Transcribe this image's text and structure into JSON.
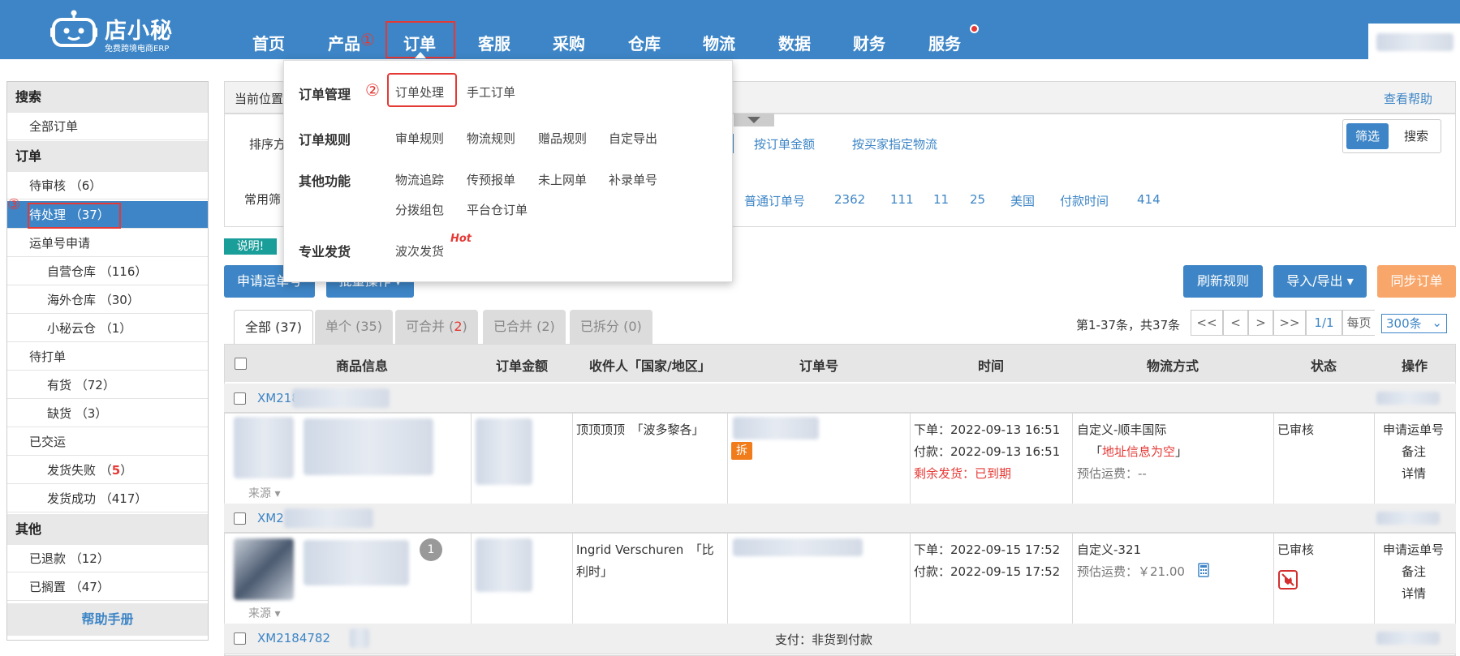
{
  "brand": {
    "name": "店小秘",
    "tagline": "免费跨境电商ERP"
  },
  "nav": {
    "items": [
      "首页",
      "产品",
      "订单",
      "客服",
      "采购",
      "仓库",
      "物流",
      "数据",
      "财务",
      "服务"
    ],
    "step1": "①"
  },
  "sidebar": {
    "search_head": "搜索",
    "all_orders": "全部订单",
    "order_head": "订单",
    "pending_review": "待审核 （6）",
    "step3": "③",
    "to_process": "待处理 （37）",
    "waybill_apply": "运单号申请",
    "own_warehouse": "自营仓库 （116）",
    "overseas_warehouse": "海外仓库 （30）",
    "xiaomi_cloud": "小秘云仓 （1）",
    "to_print": "待打单",
    "in_stock": "有货 （72）",
    "out_stock": "缺货 （3）",
    "shipped": "已交运",
    "ship_fail_label": "发货失败 （",
    "ship_fail_count": "5",
    "ship_fail_close": "）",
    "ship_success": "发货成功 （417）",
    "other_head": "其他",
    "refunded": "已退款 （12）",
    "on_hold": "已搁置 （47）",
    "help": "帮助手册"
  },
  "breadcrumb": {
    "prefix": "当前位置",
    "help": "查看帮助"
  },
  "filters": {
    "sort_label": "排序方",
    "sort_by_amount": "按订单金额",
    "sort_by_buyer_logistics": "按买家指定物流",
    "filter_btn": "筛选",
    "search_btn": "搜索",
    "common_label": "常用筛",
    "common": [
      "普通订单号",
      "2362",
      "111",
      "11",
      "25",
      "美国",
      "付款时间",
      "414"
    ]
  },
  "notice": "说明!",
  "actions": {
    "apply_waybill": "申请运单号",
    "batch": "批量操作 ▾",
    "refresh_rules": "刷新规则",
    "import_export": "导入/导出 ▾",
    "sync": "同步订单"
  },
  "tabs": [
    {
      "label": "全部 (37)"
    },
    {
      "label": "单个 (35)"
    },
    {
      "label_pre": "可合并 (",
      "label_num": "2",
      "label_post": ")"
    },
    {
      "label": "已合并 (2)"
    },
    {
      "label": "已拆分 (0)"
    }
  ],
  "pagination": {
    "summary": "第1-37条，共37条",
    "first": "<<",
    "prev": "<",
    "next": ">",
    "last": ">>",
    "page": "1/1",
    "per_page_label": "每页",
    "per_page": "300条"
  },
  "table": {
    "headers": [
      "商品信息",
      "订单金额",
      "收件人「国家/地区」",
      "订单号",
      "时间",
      "物流方式",
      "状态",
      "操作"
    ],
    "rows": [
      {
        "order_id": "XM218",
        "source": "来源",
        "recipient": "顶顶顶顶　「波多黎各」",
        "split_tag": "拆",
        "order_time": "下单：2022-09-13 16:51",
        "pay_time": "付款：2022-09-13 16:51",
        "remaining": "剩余发货：已到期",
        "logistics": "自定义-顺丰国际",
        "logistics_warn_pre": "「",
        "logistics_warn": "地址信息为空",
        "logistics_warn_post": "」",
        "freight": "预估运费：--",
        "status": "已审核",
        "ops": [
          "申请运单号",
          "备注",
          "详情"
        ]
      },
      {
        "order_id": "XM2",
        "badge": "1",
        "source": "来源",
        "recipient_line1": "Ingrid Verschuren　「比",
        "recipient_line2": "利时」",
        "order_time": "下单：2022-09-15 17:52",
        "pay_time": "付款：2022-09-15 17:52",
        "logistics": "自定义-321",
        "freight": "预估运费：￥21.00",
        "status": "已审核",
        "ops": [
          "申请运单号",
          "备注",
          "详情"
        ]
      },
      {
        "order_id": "XM2184782",
        "payment": "支付：非货到付款"
      }
    ]
  },
  "dropdown": {
    "sections": [
      {
        "title": "订单管理",
        "items": [
          "订单处理",
          "手工订单"
        ]
      },
      {
        "title": "订单规则",
        "items": [
          "审单规则",
          "物流规则",
          "赠品规则",
          "自定导出"
        ]
      },
      {
        "title": "其他功能",
        "items": [
          "物流追踪",
          "传预报单",
          "未上网单",
          "补录单号",
          "分拨组包",
          "平台仓订单"
        ]
      },
      {
        "title": "专业发货",
        "items": [
          "波次发货"
        ]
      }
    ],
    "step2": "②",
    "hot": "Hot"
  },
  "colors": {
    "primary": "#3d85c6",
    "red": "#e53935",
    "orange": "#f8a66a",
    "teal": "#1a9e9a"
  }
}
